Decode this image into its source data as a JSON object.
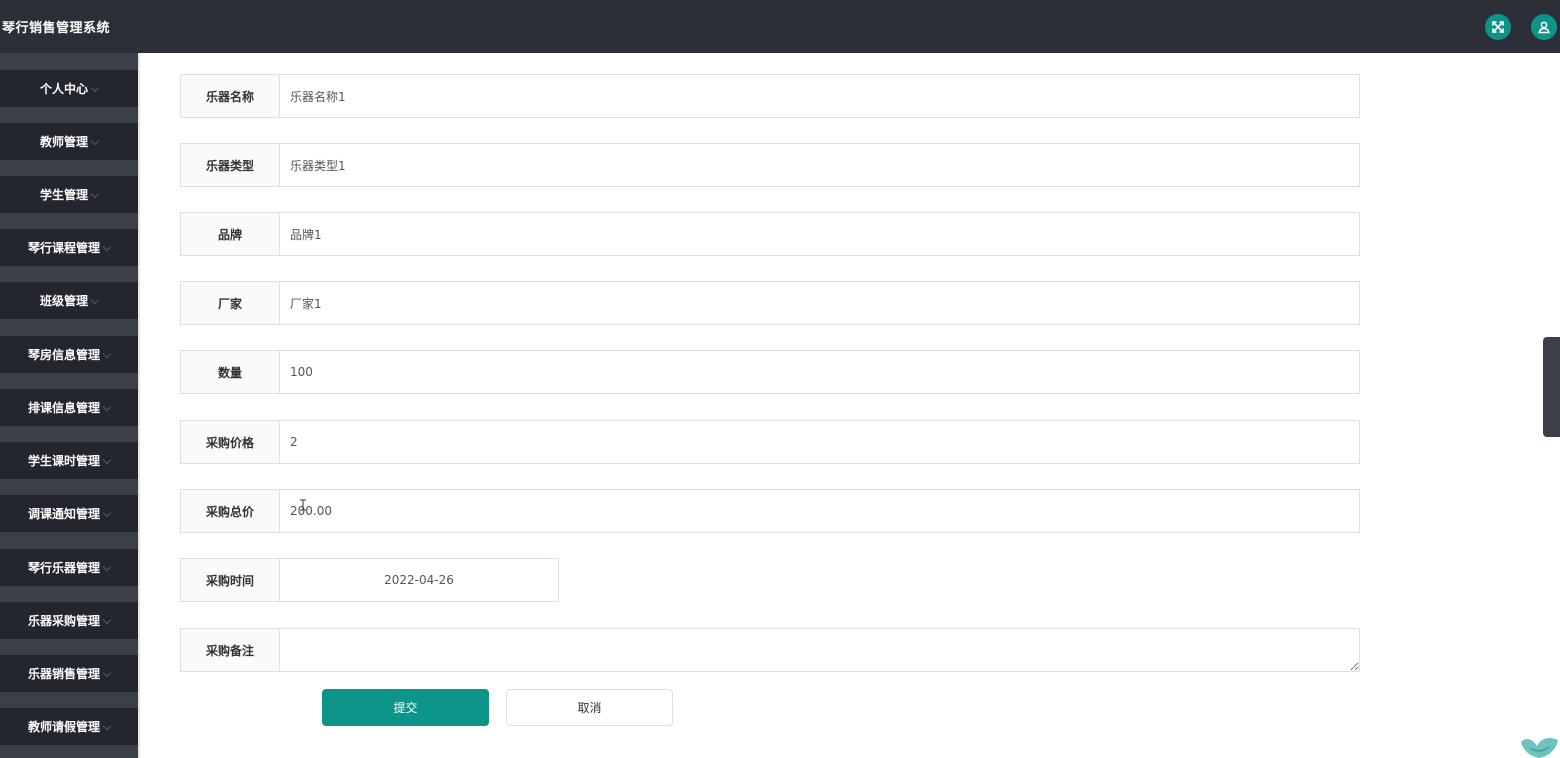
{
  "header": {
    "title": "琴行销售管理系统",
    "icons": [
      "fullscreen-icon",
      "user-icon"
    ],
    "accent_color": "#0d9488",
    "bar_color": "#2b2f38"
  },
  "sidebar": {
    "items": [
      {
        "label": "个人中心"
      },
      {
        "label": "教师管理"
      },
      {
        "label": "学生管理"
      },
      {
        "label": "琴行课程管理"
      },
      {
        "label": "班级管理"
      },
      {
        "label": "琴房信息管理"
      },
      {
        "label": "排课信息管理"
      },
      {
        "label": "学生课时管理"
      },
      {
        "label": "调课通知管理"
      },
      {
        "label": "琴行乐器管理"
      },
      {
        "label": "乐器采购管理"
      },
      {
        "label": "乐器销售管理"
      },
      {
        "label": "教师请假管理"
      }
    ]
  },
  "form": {
    "fields": [
      {
        "label": "乐器名称",
        "value": "乐器名称1"
      },
      {
        "label": "乐器类型",
        "value": "乐器类型1"
      },
      {
        "label": "品牌",
        "value": "品牌1"
      },
      {
        "label": "厂家",
        "value": "厂家1"
      },
      {
        "label": "数量",
        "value": "100"
      },
      {
        "label": "采购价格",
        "value": "2"
      },
      {
        "label": "采购总价",
        "value": "200.00"
      },
      {
        "label": "采购时间",
        "value": "2022-04-26"
      },
      {
        "label": "采购备注",
        "value": ""
      }
    ],
    "submit_label": "提交",
    "cancel_label": "取消"
  }
}
